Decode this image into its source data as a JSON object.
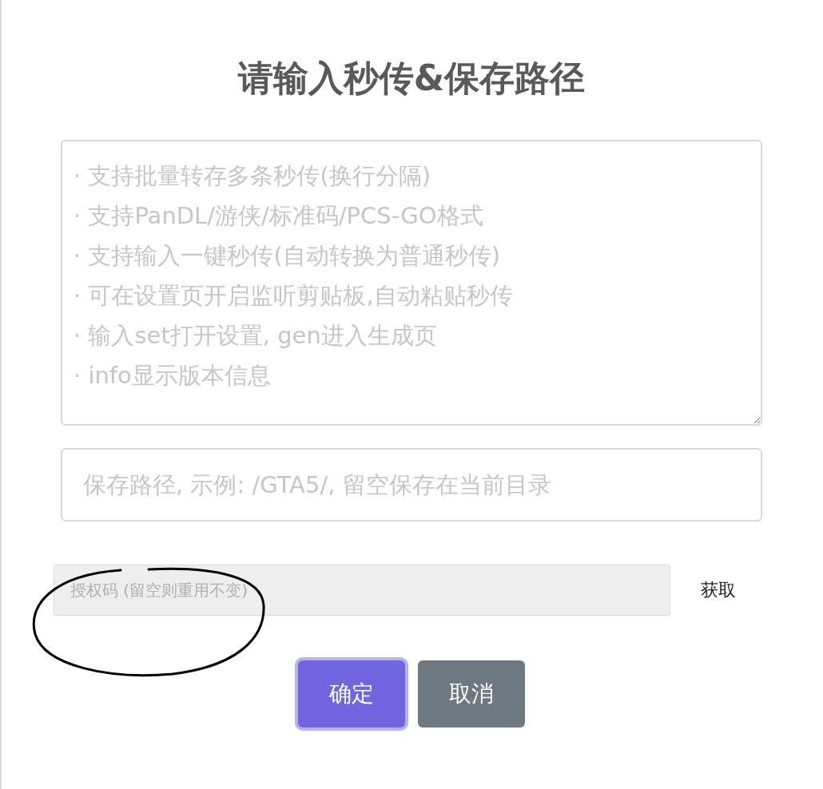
{
  "dialog": {
    "title": "请输入秒传&保存路径",
    "links_textarea": {
      "placeholder": "· 支持批量转存多条秒传(换行分隔)\n· 支持PanDL/游侠/标准码/PCS-GO格式\n· 支持输入一键秒传(自动转换为普通秒传)\n· 可在设置页开启监听剪贴板,自动粘贴秒传\n· 输入set打开设置, gen进入生成页\n· info显示版本信息"
    },
    "path_field": {
      "placeholder": "保存路径, 示例: /GTA5/, 留空保存在当前目录"
    },
    "auth_field": {
      "placeholder": "授权码 (留空则重用不变)",
      "disabled": true
    },
    "get_link": "获取",
    "buttons": [
      {
        "label": "确定",
        "kind": "confirm",
        "focused": true
      },
      {
        "label": "取消",
        "kind": "cancel",
        "focused": false
      }
    ]
  }
}
